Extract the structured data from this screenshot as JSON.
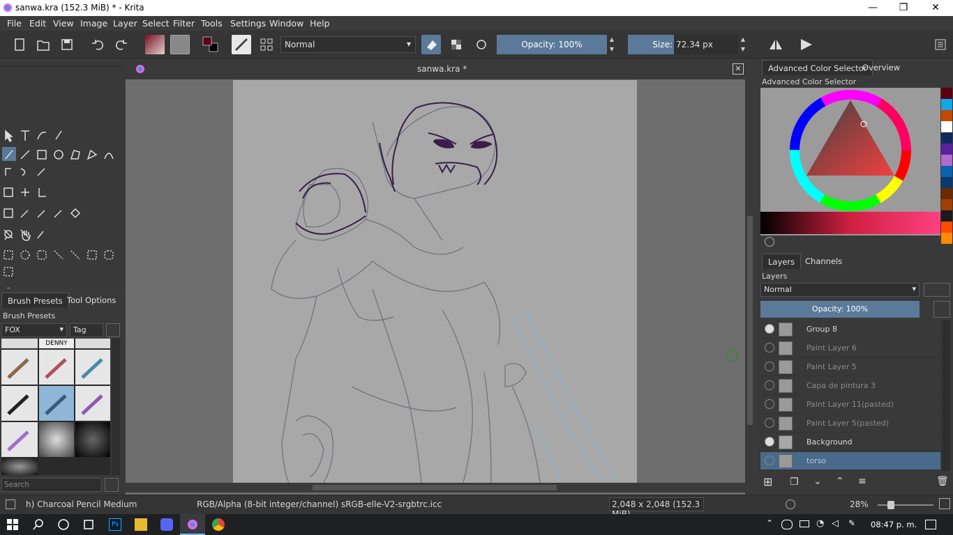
{
  "window": {
    "title": "sanwa.kra (152.3 MiB)  * - Krita",
    "minimize": "—",
    "restore": "❐",
    "close": "✕"
  },
  "menu": [
    "File",
    "Edit",
    "View",
    "Image",
    "Layer",
    "Select",
    "Filter",
    "Tools",
    "Settings",
    "Window",
    "Help"
  ],
  "toolbar": {
    "blend_mode": "Normal",
    "opacity_label": "Opacity: 100%",
    "size_label": "Size:",
    "size_value": "72.34 px"
  },
  "document": {
    "tab_title": "sanwa.kra *"
  },
  "brush_panel": {
    "tabs": [
      "Brush Presets",
      "Tool Options"
    ],
    "title": "Brush Presets",
    "tag_filter": "FOX",
    "tag_button": "Tag",
    "search_placeholder": "Search",
    "denny_label": "DENNY"
  },
  "color_panel": {
    "tabs": [
      "Advanced Color Selector",
      "Overview"
    ],
    "title": "Advanced Color Selector"
  },
  "layers_panel": {
    "tabs": [
      "Layers",
      "Channels"
    ],
    "title": "Layers",
    "blend_mode": "Normal",
    "opacity": "Opacity:  100%",
    "layers": [
      {
        "name": "Group 8",
        "visible": true
      },
      {
        "name": "Paint Layer 6",
        "visible": false
      },
      {
        "name": "Paint Layer 5",
        "visible": false
      },
      {
        "name": "Capa de pintura 3",
        "visible": false
      },
      {
        "name": "Paint Layer 11(pasted)",
        "visible": false
      },
      {
        "name": "Paint Layer 5(pasted)",
        "visible": false
      },
      {
        "name": "Background",
        "visible": true
      },
      {
        "name": "torso",
        "visible": false
      }
    ]
  },
  "status": {
    "brush": "h) Charcoal Pencil Medium",
    "color_space": "RGB/Alpha (8-bit integer/channel)  sRGB-elle-V2-srgbtrc.icc",
    "dimensions": "2,048 x 2,048 (152.3 MiB)",
    "zoom": "28%"
  },
  "taskbar": {
    "time": "08:47 p. m."
  },
  "colors": {
    "accent": "#5b7a99",
    "layer_selected": "#4a6a8c",
    "line_dark": "#3a1e4a",
    "line_light": "#6f6f7a",
    "line_blue": "#7fb3d6"
  },
  "palette": [
    "#5a0010",
    "#13a6e6",
    "#c04a00",
    "#ffffff",
    "#0f2a5e",
    "#5a20a0",
    "#b06ad0",
    "#0a63b0",
    "#0a3a6e",
    "#6b2a00",
    "#a04000",
    "#1a1a1a",
    "#ff4a00",
    "#ff8a00"
  ]
}
